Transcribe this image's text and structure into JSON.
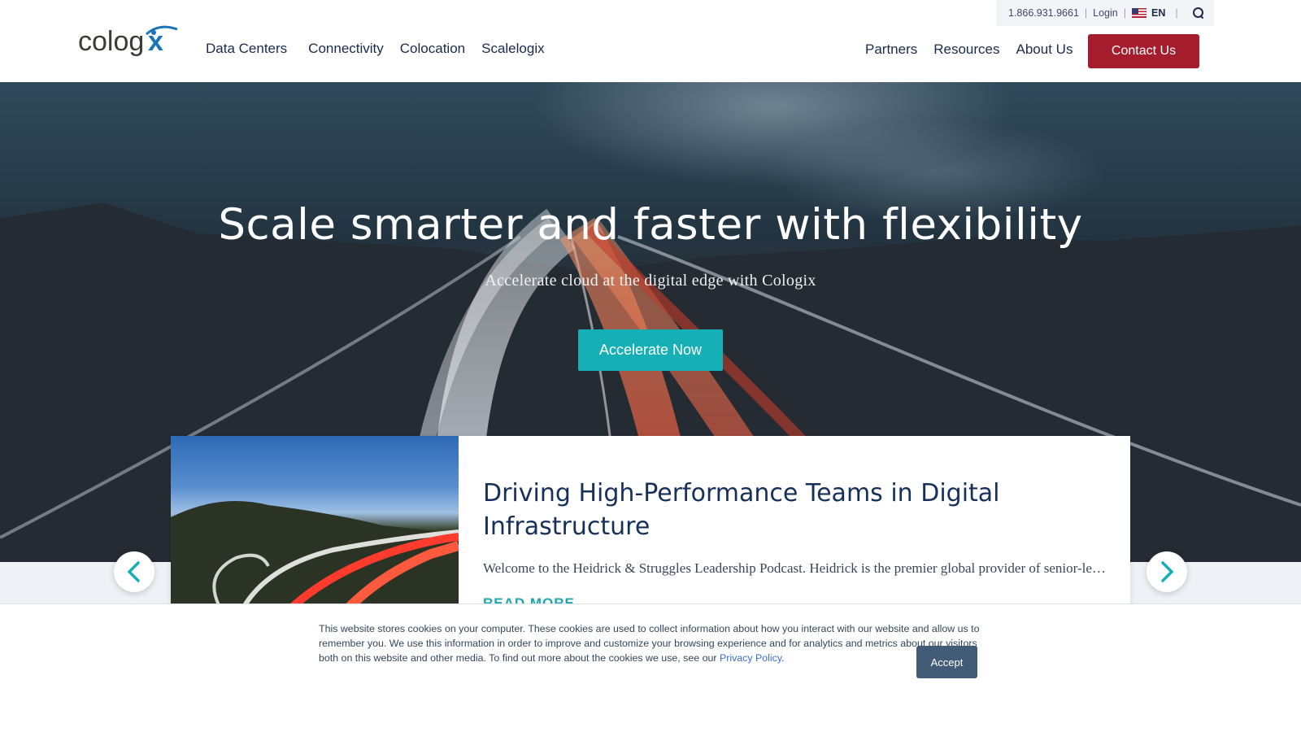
{
  "utility": {
    "phone": "1.866.931.9661",
    "login": "Login",
    "language": "EN"
  },
  "brand": {
    "logo_text": "cologix"
  },
  "nav": {
    "left": [
      "Data Centers",
      "Connectivity",
      "Colocation",
      "Scalelogix"
    ],
    "right": [
      "Partners",
      "Resources",
      "About Us"
    ],
    "contact_label": "Contact Us"
  },
  "hero": {
    "title": "Scale smarter and faster with flexibility",
    "subtitle": "Accelerate cloud at the digital edge with Cologix",
    "cta_label": "Accelerate Now"
  },
  "card": {
    "title": "Driving High-Performance Teams in Digital Infrastructure",
    "text": "Welcome to the Heidrick & Struggles Leadership Podcast. Heidrick is the premier global provider of senior-level executive search and leadership consulting services.",
    "read_more": "READ MORE"
  },
  "cookie": {
    "text": "This website stores cookies on your computer. These cookies are used to collect information about how you interact with our website and allow us to remember you. We use this information in order to improve and customize your browsing experience and for analytics and metrics about our visitors both on this website and other media. To find out more about the cookies we use, see our ",
    "link": "Privacy Policy",
    "suffix": ".",
    "accept_label": "Accept"
  },
  "colors": {
    "brand_red": "#a51d2d",
    "teal": "#14b0b6",
    "navy": "#17305a",
    "accept": "#425b76"
  },
  "icons": [
    "flag-us-icon",
    "search-icon",
    "chevron-left-icon",
    "chevron-right-icon"
  ]
}
